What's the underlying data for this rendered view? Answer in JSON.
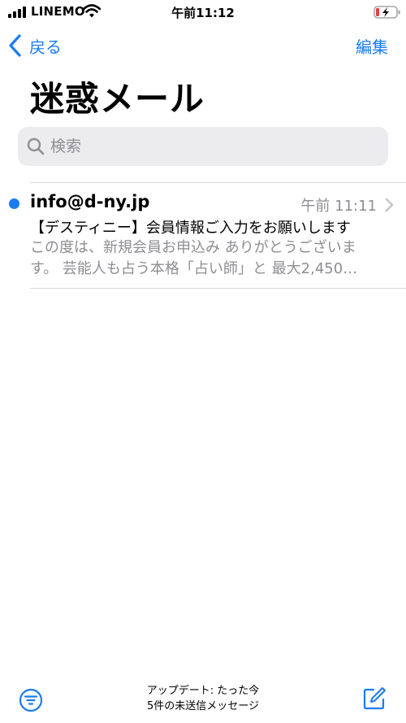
{
  "status_bar": {
    "carrier": "LINEMO",
    "time": "午前11:12"
  },
  "nav": {
    "back_label": "戻る",
    "edit_label": "編集"
  },
  "title": "迷惑メール",
  "search": {
    "placeholder": "検索"
  },
  "messages": [
    {
      "sender": "info@d-ny.jp",
      "time": "午前 11:11",
      "subject": "【デスティニー】会員情報ご入力をお願いします",
      "preview": "この度は、新規会員お申込み ありがとうございます。 芸能人も占う本格「占い師」と 最大2,450…",
      "unread": true
    }
  ],
  "toolbar": {
    "update_status": "アップデート: たった今",
    "unsent_status": "5件の未送信メッセージ"
  },
  "colors": {
    "accent": "#1a7cf0",
    "secondary_text": "#8e8e93",
    "battery_low": "#e0423a"
  },
  "icons": [
    "signal-icon",
    "wifi-icon",
    "battery-icon",
    "back-chevron-icon",
    "search-icon",
    "chevron-right-icon",
    "filter-icon",
    "compose-icon"
  ]
}
